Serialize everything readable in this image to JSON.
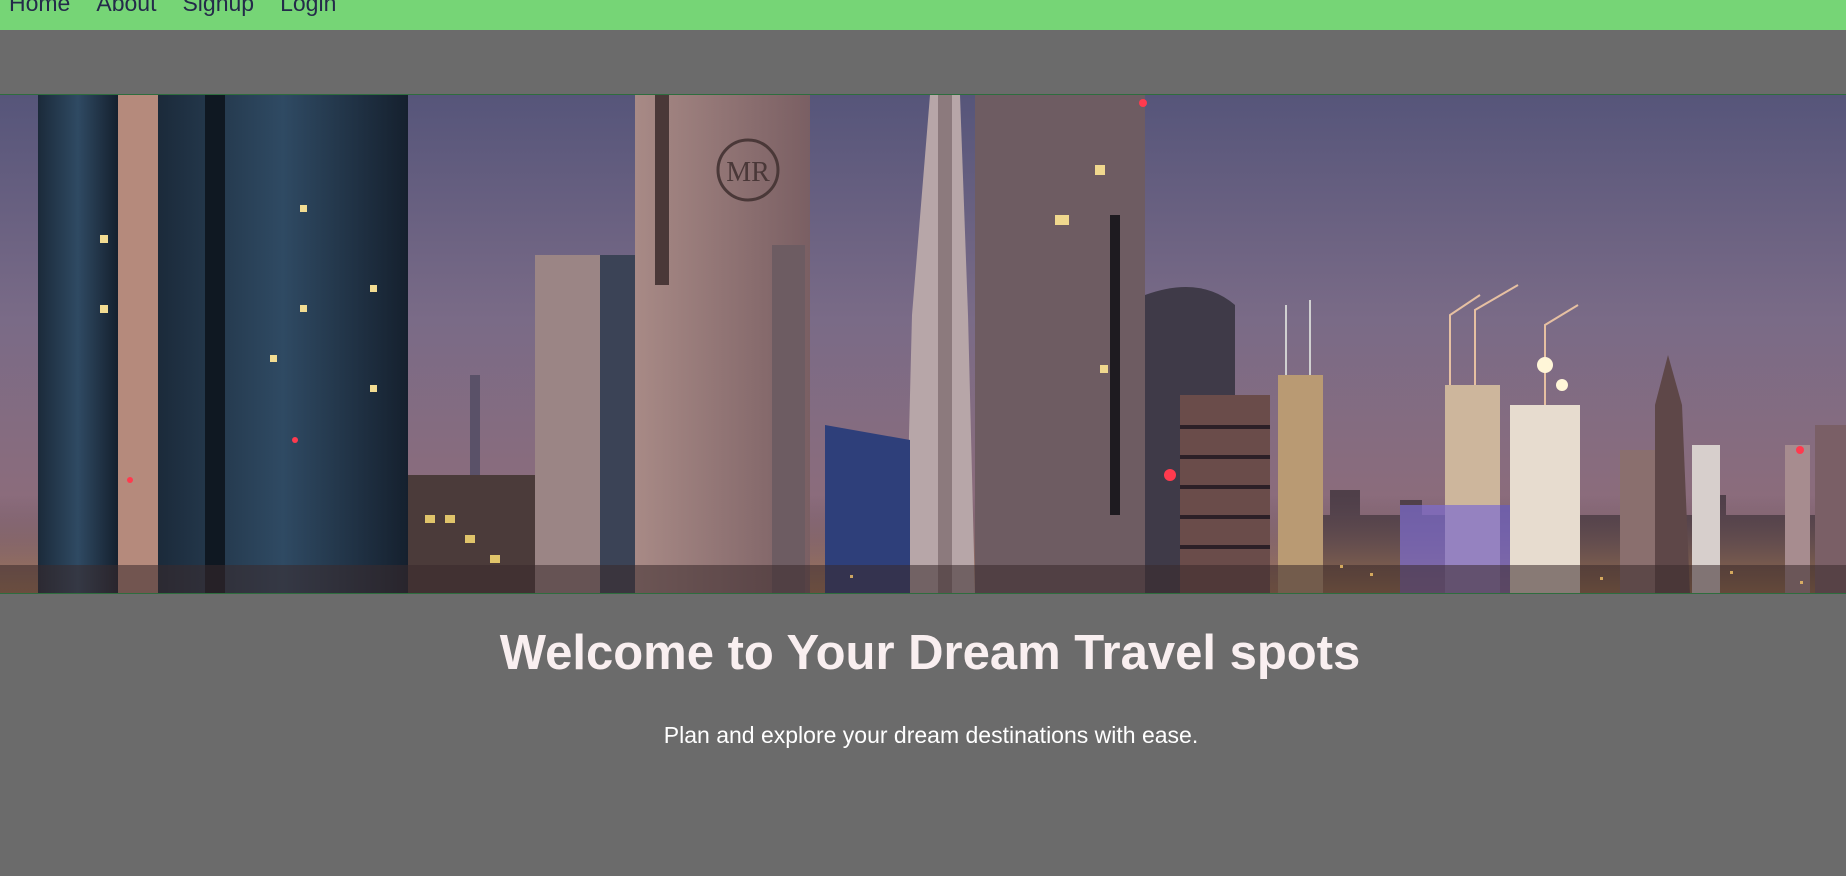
{
  "nav": {
    "links": [
      "Home",
      "About",
      "Signup",
      "Login"
    ]
  },
  "hero": {
    "image_subject": "night city skyline with skyscrapers and construction cranes",
    "logo_lettering": "MR"
  },
  "main": {
    "headline": "Welcome to Your Dream Travel spots",
    "tagline": "Plan and explore your dream destinations with ease."
  },
  "colors": {
    "navbar": "#76d576",
    "page_background": "#6b6b6b",
    "nav_text": "#242a4a",
    "headline_text": "#f9eff0"
  }
}
